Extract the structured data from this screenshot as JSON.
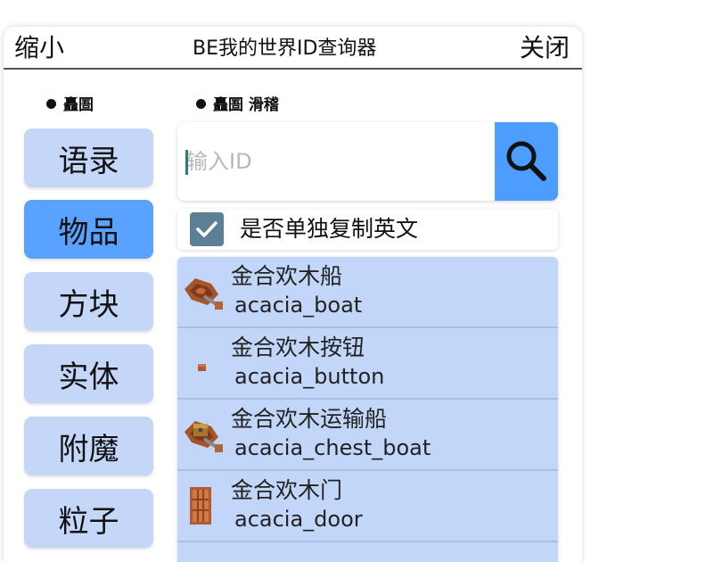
{
  "window": {
    "title": "BE我的世界ID查询器",
    "minimize_label": "缩小",
    "close_label": "关闭"
  },
  "status": {
    "left": "矗圄",
    "right": "矗圄 滑稽"
  },
  "categories": [
    {
      "label": "语录",
      "active": false
    },
    {
      "label": "物品",
      "active": true
    },
    {
      "label": "方块",
      "active": false
    },
    {
      "label": "实体",
      "active": false
    },
    {
      "label": "附魔",
      "active": false
    },
    {
      "label": "粒子",
      "active": false
    }
  ],
  "search": {
    "placeholder": "输入ID",
    "value": "",
    "button_icon": "search-icon"
  },
  "copy_english_only": {
    "label": "是否单独复制英文",
    "checked": true
  },
  "results": [
    {
      "name": "金合欢木船",
      "id": "acacia_boat",
      "icon": "acacia-boat-icon"
    },
    {
      "name": "金合欢木按钮",
      "id": "acacia_button",
      "icon": "acacia-button-icon"
    },
    {
      "name": "金合欢木运输船",
      "id": "acacia_chest_boat",
      "icon": "acacia-chest-boat-icon"
    },
    {
      "name": "金合欢木门",
      "id": "acacia_door",
      "icon": "acacia-door-icon"
    }
  ],
  "colors": {
    "category_bg": "#c5d7f9",
    "category_active_bg": "#5aa2ff",
    "search_button_bg": "#4d9dff",
    "list_bg": "#c1d6f8",
    "checkbox_bg": "#5b7f94"
  }
}
